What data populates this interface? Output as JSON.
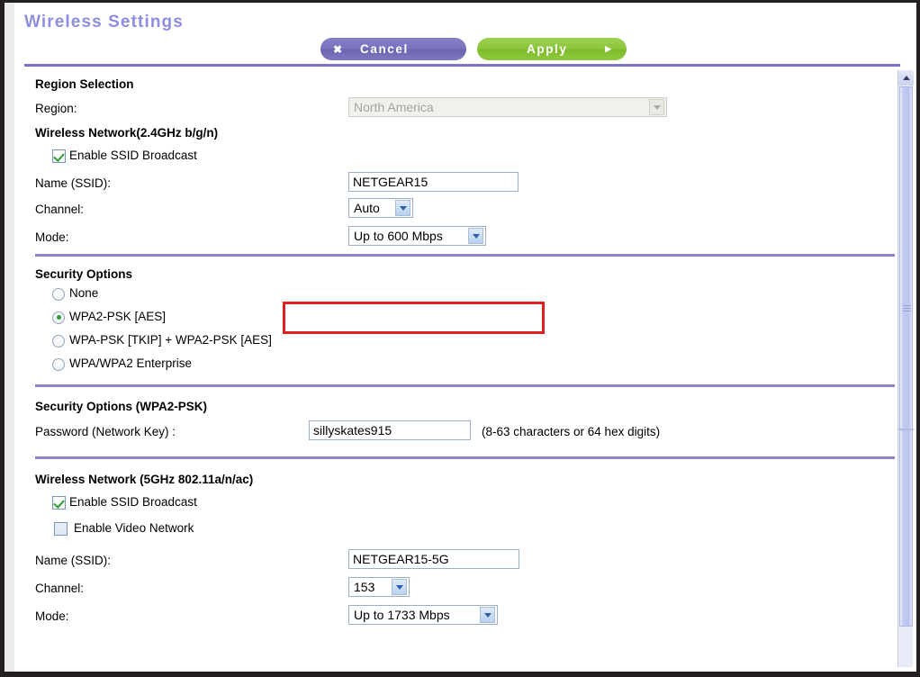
{
  "page_title": "Wireless Settings",
  "toolbar": {
    "cancel_label": "Cancel",
    "cancel_icon": "close-x-icon",
    "cancel_icon_glyph": "✖",
    "apply_label": "Apply",
    "apply_icon": "play-arrow-icon",
    "apply_icon_glyph": "▶",
    "cancel_color": "#7a74bd",
    "apply_color": "#8cc63f"
  },
  "colors": {
    "title": "#8e8ee0",
    "divider": "#8b84cd",
    "highlight_box": "#e02020",
    "checkmark": "#2f9e2f"
  },
  "region_section": {
    "heading": "Region Selection",
    "region_label": "Region:",
    "region_value": "North America",
    "region_disabled": true
  },
  "wireless_24": {
    "heading": "Wireless Network(2.4GHz b/g/n)",
    "ssid_broadcast_label": "Enable SSID Broadcast",
    "ssid_broadcast_checked": true,
    "name_label": "Name (SSID):",
    "name_value": "NETGEAR15",
    "channel_label": "Channel:",
    "channel_value": "Auto",
    "mode_label": "Mode:",
    "mode_value": "Up to 600 Mbps",
    "mode_highlighted": true
  },
  "security_options": {
    "heading": "Security Options",
    "options": [
      {
        "label": "None",
        "selected": false
      },
      {
        "label": "WPA2-PSK [AES]",
        "selected": true
      },
      {
        "label": "WPA-PSK [TKIP] + WPA2-PSK [AES]",
        "selected": false
      },
      {
        "label": "WPA/WPA2 Enterprise",
        "selected": false
      }
    ]
  },
  "security_wpa2": {
    "heading": "Security Options (WPA2-PSK)",
    "password_label": "Password (Network Key) :",
    "password_value": "sillyskates915",
    "password_hint": "(8-63 characters or 64 hex digits)"
  },
  "wireless_5g": {
    "heading": "Wireless Network (5GHz 802.11a/n/ac)",
    "ssid_broadcast_label": "Enable SSID Broadcast",
    "ssid_broadcast_checked": true,
    "video_network_label": "Enable Video Network",
    "video_network_checked": false,
    "name_label": "Name (SSID):",
    "name_value": "NETGEAR15-5G",
    "channel_label": "Channel:",
    "channel_value": "153",
    "mode_label": "Mode:",
    "mode_value": "Up to 1733 Mbps"
  },
  "scrollbar": {
    "up_icon": "chevron-up-icon",
    "down_icon": "chevron-down-icon"
  }
}
